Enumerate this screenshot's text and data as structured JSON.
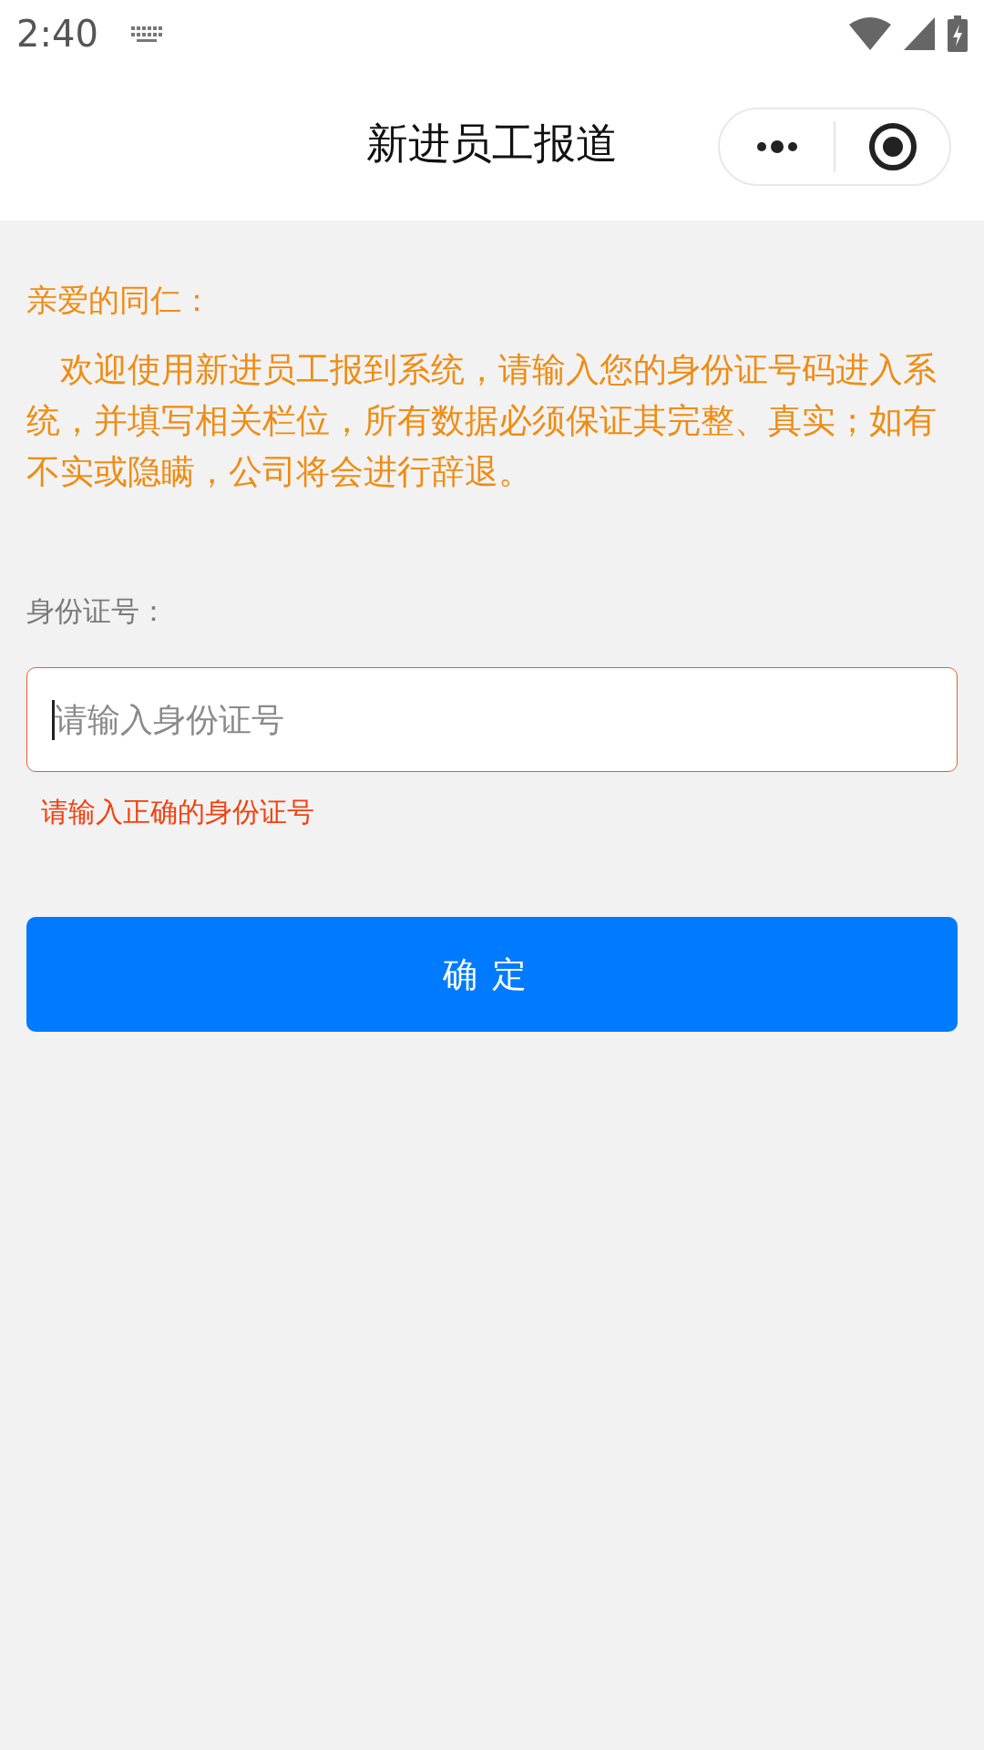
{
  "status_bar": {
    "time": "2:40"
  },
  "nav_bar": {
    "title": "新进员工报道"
  },
  "notice": {
    "greeting": "亲爱的同仁：",
    "body": "欢迎使用新进员工报到系统，请输入您的身份证号码进入系统，并填写相关栏位，所有数据必须保证其完整、真实；如有不实或隐瞒，公司将会进行辞退。"
  },
  "form": {
    "label": "身份证号：",
    "field": {
      "placeholder": "请输入身份证号",
      "focused": true,
      "invalid": true
    },
    "error": "请输入正确的身份证号"
  },
  "buttons": [
    {
      "label": "确定",
      "kind": "primary"
    }
  ]
}
